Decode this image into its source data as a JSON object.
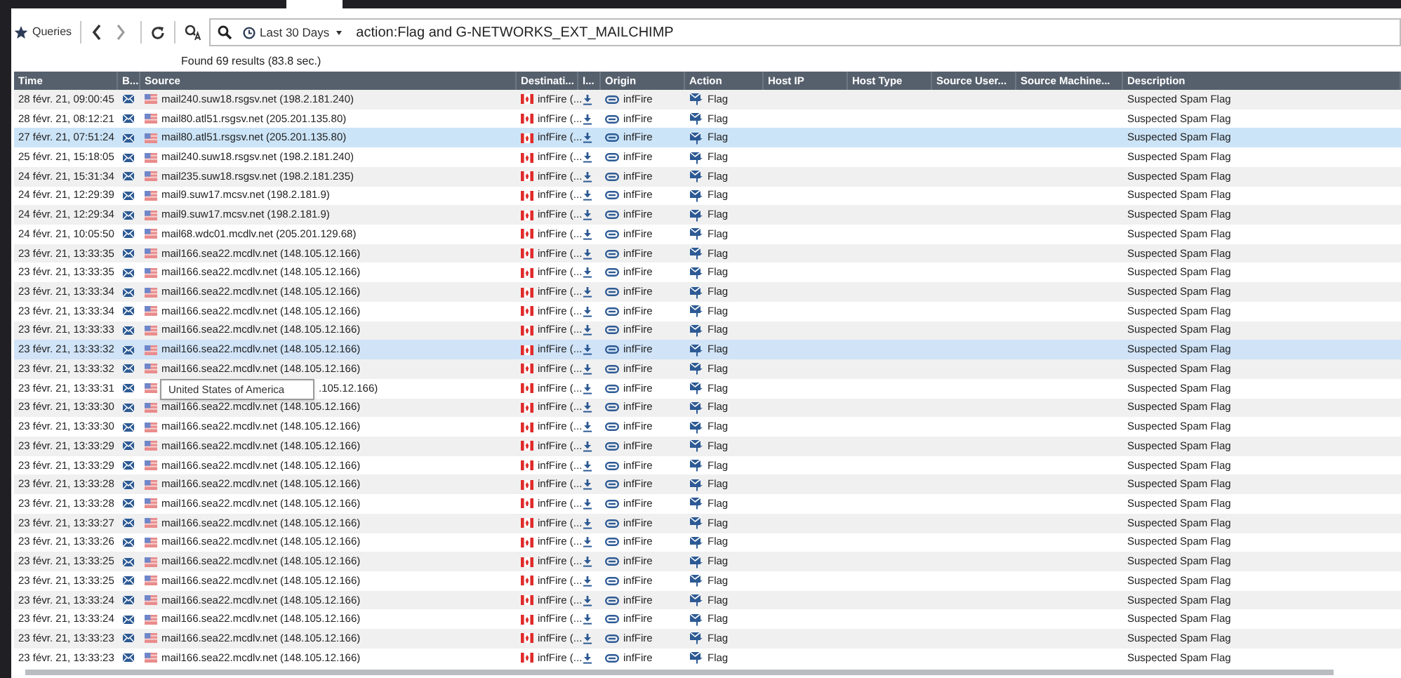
{
  "toolbar": {
    "queries_label": "Queries",
    "search": {
      "time_range": "Last 30 Days",
      "query": "action:Flag and G-NETWORKS_EXT_MAILCHIMP"
    }
  },
  "results_text": "Found 69 results (83.8 sec.)",
  "columns": [
    "Time",
    "B...",
    "Source",
    "Destinati...",
    "I...",
    "Origin",
    "Action",
    "Host IP",
    "Host Type",
    "Source User...",
    "Source Machine...",
    "Description"
  ],
  "rows": [
    {
      "time": "28 févr. 21, 09:00:45",
      "source": "mail240.suw18.rsgsv.net (198.2.181.240)",
      "destination": "infFire (...",
      "origin": "infFire",
      "action": "Flag",
      "description": "Suspected Spam Flag",
      "selected": false,
      "hovered": false
    },
    {
      "time": "28 févr. 21, 08:12:21",
      "source": "mail80.atl51.rsgsv.net (205.201.135.80)",
      "destination": "infFire (...",
      "origin": "infFire",
      "action": "Flag",
      "description": "Suspected Spam Flag",
      "selected": false,
      "hovered": false
    },
    {
      "time": "27 févr. 21, 07:51:24",
      "source": "mail80.atl51.rsgsv.net (205.201.135.80)",
      "destination": "infFire (...",
      "origin": "infFire",
      "action": "Flag",
      "description": "Suspected Spam Flag",
      "selected": true,
      "hovered": false
    },
    {
      "time": "25 févr. 21, 15:18:05",
      "source": "mail240.suw18.rsgsv.net (198.2.181.240)",
      "destination": "infFire (...",
      "origin": "infFire",
      "action": "Flag",
      "description": "Suspected Spam Flag",
      "selected": false,
      "hovered": false
    },
    {
      "time": "24 févr. 21, 15:31:34",
      "source": "mail235.suw18.rsgsv.net (198.2.181.235)",
      "destination": "infFire (...",
      "origin": "infFire",
      "action": "Flag",
      "description": "Suspected Spam Flag",
      "selected": false,
      "hovered": false
    },
    {
      "time": "24 févr. 21, 12:29:39",
      "source": "mail9.suw17.mcsv.net (198.2.181.9)",
      "destination": "infFire (...",
      "origin": "infFire",
      "action": "Flag",
      "description": "Suspected Spam Flag",
      "selected": false,
      "hovered": false
    },
    {
      "time": "24 févr. 21, 12:29:34",
      "source": "mail9.suw17.mcsv.net (198.2.181.9)",
      "destination": "infFire (...",
      "origin": "infFire",
      "action": "Flag",
      "description": "Suspected Spam Flag",
      "selected": false,
      "hovered": false
    },
    {
      "time": "24 févr. 21, 10:05:50",
      "source": "mail68.wdc01.mcdlv.net (205.201.129.68)",
      "destination": "infFire (...",
      "origin": "infFire",
      "action": "Flag",
      "description": "Suspected Spam Flag",
      "selected": false,
      "hovered": false
    },
    {
      "time": "23 févr. 21, 13:33:35",
      "source": "mail166.sea22.mcdlv.net (148.105.12.166)",
      "destination": "infFire (...",
      "origin": "infFire",
      "action": "Flag",
      "description": "Suspected Spam Flag",
      "selected": false,
      "hovered": false
    },
    {
      "time": "23 févr. 21, 13:33:35",
      "source": "mail166.sea22.mcdlv.net (148.105.12.166)",
      "destination": "infFire (...",
      "origin": "infFire",
      "action": "Flag",
      "description": "Suspected Spam Flag",
      "selected": false,
      "hovered": false
    },
    {
      "time": "23 févr. 21, 13:33:34",
      "source": "mail166.sea22.mcdlv.net (148.105.12.166)",
      "destination": "infFire (...",
      "origin": "infFire",
      "action": "Flag",
      "description": "Suspected Spam Flag",
      "selected": false,
      "hovered": false
    },
    {
      "time": "23 févr. 21, 13:33:34",
      "source": "mail166.sea22.mcdlv.net (148.105.12.166)",
      "destination": "infFire (...",
      "origin": "infFire",
      "action": "Flag",
      "description": "Suspected Spam Flag",
      "selected": false,
      "hovered": false
    },
    {
      "time": "23 févr. 21, 13:33:33",
      "source": "mail166.sea22.mcdlv.net (148.105.12.166)",
      "destination": "infFire (...",
      "origin": "infFire",
      "action": "Flag",
      "description": "Suspected Spam Flag",
      "selected": false,
      "hovered": false
    },
    {
      "time": "23 févr. 21, 13:33:32",
      "source": "mail166.sea22.mcdlv.net (148.105.12.166)",
      "destination": "infFire (...",
      "origin": "infFire",
      "action": "Flag",
      "description": "Suspected Spam Flag",
      "selected": false,
      "hovered": true
    },
    {
      "time": "23 févr. 21, 13:33:32",
      "source": "mail166.sea22.mcdlv.net (148.105.12.166)",
      "destination": "infFire (...",
      "origin": "infFire",
      "action": "Flag",
      "description": "Suspected Spam Flag",
      "selected": false,
      "hovered": false
    },
    {
      "time": "23 févr. 21, 13:33:31",
      "source": ".105.12.166)",
      "tooltip": "United States of America",
      "destination": "infFire (...",
      "origin": "infFire",
      "action": "Flag",
      "description": "Suspected Spam Flag",
      "selected": false,
      "hovered": false
    },
    {
      "time": "23 févr. 21, 13:33:30",
      "source": "mail166.sea22.mcdlv.net (148.105.12.166)",
      "destination": "infFire (...",
      "origin": "infFire",
      "action": "Flag",
      "description": "Suspected Spam Flag",
      "selected": false,
      "hovered": false
    },
    {
      "time": "23 févr. 21, 13:33:30",
      "source": "mail166.sea22.mcdlv.net (148.105.12.166)",
      "destination": "infFire (...",
      "origin": "infFire",
      "action": "Flag",
      "description": "Suspected Spam Flag",
      "selected": false,
      "hovered": false
    },
    {
      "time": "23 févr. 21, 13:33:29",
      "source": "mail166.sea22.mcdlv.net (148.105.12.166)",
      "destination": "infFire (...",
      "origin": "infFire",
      "action": "Flag",
      "description": "Suspected Spam Flag",
      "selected": false,
      "hovered": false
    },
    {
      "time": "23 févr. 21, 13:33:29",
      "source": "mail166.sea22.mcdlv.net (148.105.12.166)",
      "destination": "infFire (...",
      "origin": "infFire",
      "action": "Flag",
      "description": "Suspected Spam Flag",
      "selected": false,
      "hovered": false
    },
    {
      "time": "23 févr. 21, 13:33:28",
      "source": "mail166.sea22.mcdlv.net (148.105.12.166)",
      "destination": "infFire (...",
      "origin": "infFire",
      "action": "Flag",
      "description": "Suspected Spam Flag",
      "selected": false,
      "hovered": false
    },
    {
      "time": "23 févr. 21, 13:33:28",
      "source": "mail166.sea22.mcdlv.net (148.105.12.166)",
      "destination": "infFire (...",
      "origin": "infFire",
      "action": "Flag",
      "description": "Suspected Spam Flag",
      "selected": false,
      "hovered": false
    },
    {
      "time": "23 févr. 21, 13:33:27",
      "source": "mail166.sea22.mcdlv.net (148.105.12.166)",
      "destination": "infFire (...",
      "origin": "infFire",
      "action": "Flag",
      "description": "Suspected Spam Flag",
      "selected": false,
      "hovered": false
    },
    {
      "time": "23 févr. 21, 13:33:26",
      "source": "mail166.sea22.mcdlv.net (148.105.12.166)",
      "destination": "infFire (...",
      "origin": "infFire",
      "action": "Flag",
      "description": "Suspected Spam Flag",
      "selected": false,
      "hovered": false
    },
    {
      "time": "23 févr. 21, 13:33:25",
      "source": "mail166.sea22.mcdlv.net (148.105.12.166)",
      "destination": "infFire (...",
      "origin": "infFire",
      "action": "Flag",
      "description": "Suspected Spam Flag",
      "selected": false,
      "hovered": false
    },
    {
      "time": "23 févr. 21, 13:33:25",
      "source": "mail166.sea22.mcdlv.net (148.105.12.166)",
      "destination": "infFire (...",
      "origin": "infFire",
      "action": "Flag",
      "description": "Suspected Spam Flag",
      "selected": false,
      "hovered": false
    },
    {
      "time": "23 févr. 21, 13:33:24",
      "source": "mail166.sea22.mcdlv.net (148.105.12.166)",
      "destination": "infFire (...",
      "origin": "infFire",
      "action": "Flag",
      "description": "Suspected Spam Flag",
      "selected": false,
      "hovered": false
    },
    {
      "time": "23 févr. 21, 13:33:24",
      "source": "mail166.sea22.mcdlv.net (148.105.12.166)",
      "destination": "infFire (...",
      "origin": "infFire",
      "action": "Flag",
      "description": "Suspected Spam Flag",
      "selected": false,
      "hovered": false
    },
    {
      "time": "23 févr. 21, 13:33:23",
      "source": "mail166.sea22.mcdlv.net (148.105.12.166)",
      "destination": "infFire (...",
      "origin": "infFire",
      "action": "Flag",
      "description": "Suspected Spam Flag",
      "selected": false,
      "hovered": false
    },
    {
      "time": "23 févr. 21, 13:33:23",
      "source": "mail166.sea22.mcdlv.net (148.105.12.166)",
      "destination": "infFire (...",
      "origin": "infFire",
      "action": "Flag",
      "description": "Suspected Spam Flag",
      "selected": false,
      "hovered": false
    }
  ]
}
